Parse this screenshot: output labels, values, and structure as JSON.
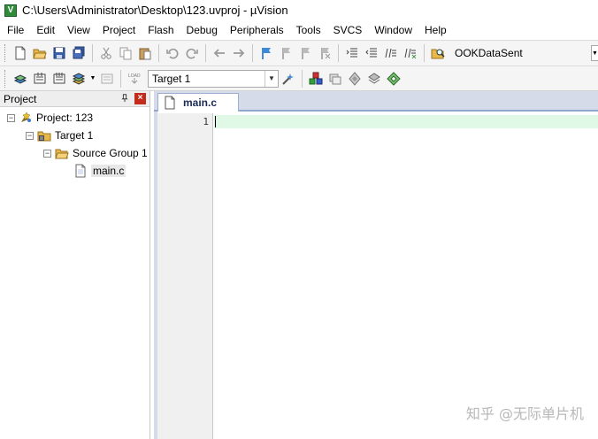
{
  "window": {
    "title": "C:\\Users\\Administrator\\Desktop\\123.uvproj - µVision",
    "app_icon": "V"
  },
  "menu": [
    "File",
    "Edit",
    "View",
    "Project",
    "Flash",
    "Debug",
    "Peripherals",
    "Tools",
    "SVCS",
    "Window",
    "Help"
  ],
  "toolbar1": {
    "find_value": "OOKDataSent"
  },
  "toolbar2": {
    "target_value": "Target 1"
  },
  "project_panel": {
    "title": "Project",
    "tree": {
      "project": "Project: 123",
      "target": "Target 1",
      "group": "Source Group 1",
      "file": "main.c"
    }
  },
  "editor": {
    "active_tab": "main.c",
    "line_numbers": [
      "1"
    ]
  },
  "watermark": "知乎 @无际单片机",
  "colors": {
    "accent_tab_border": "#8fa8cc",
    "current_line": "#e0f8e6",
    "close_button": "#c42b1c"
  }
}
